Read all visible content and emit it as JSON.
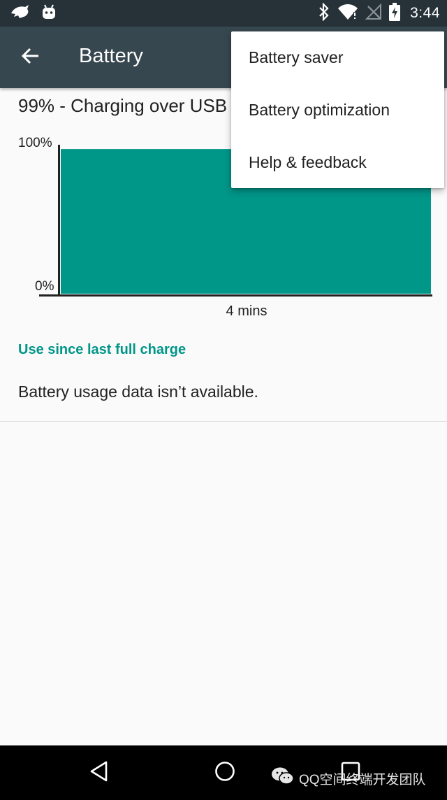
{
  "status_bar": {
    "time": "3:44",
    "icons": [
      "notification-app-icon",
      "android-debug-icon",
      "bluetooth-icon",
      "wifi-icon",
      "signal-off-icon",
      "battery-charging-icon"
    ]
  },
  "toolbar": {
    "title": "Battery",
    "back_icon": "arrow-back-icon"
  },
  "battery": {
    "status_text": "99% - Charging over USB"
  },
  "chart_data": {
    "type": "area",
    "y_tick_labels": [
      "100%",
      "0%"
    ],
    "ylim": [
      0,
      100
    ],
    "x_label": "4 mins",
    "x": [
      0,
      1
    ],
    "values": [
      99,
      99
    ],
    "fill_color": "#009688"
  },
  "usage": {
    "section_header": "Use since last full charge",
    "message": "Battery usage data isn’t available."
  },
  "overflow_menu": {
    "items": [
      {
        "label": "Battery saver"
      },
      {
        "label": "Battery optimization"
      },
      {
        "label": "Help & feedback"
      }
    ]
  },
  "nav_bar": {
    "buttons": [
      "back-icon",
      "home-icon",
      "recents-icon"
    ]
  },
  "watermark": {
    "text": "QQ空间终端开发团队"
  },
  "colors": {
    "accent": "#009688",
    "toolbar": "#37474f",
    "status_bar": "#263238"
  }
}
